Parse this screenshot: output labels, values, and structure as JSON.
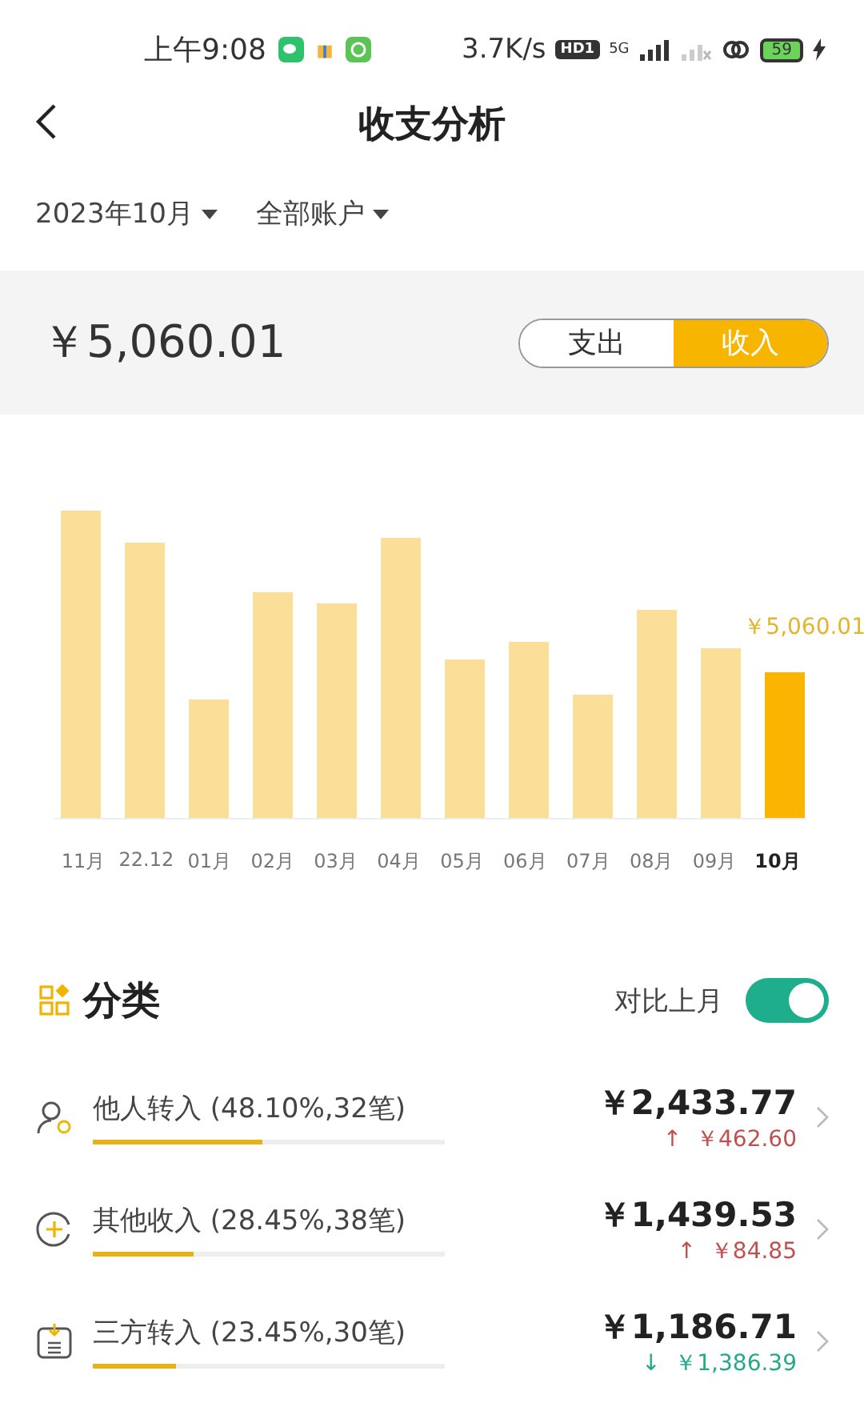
{
  "status_bar": {
    "time": "上午9:08",
    "speed": "3.7K/s",
    "hd_badge": "HD1",
    "network": "5G",
    "battery": "59"
  },
  "header": {
    "title": "收支分析"
  },
  "filters": [
    {
      "label": "2023年10月"
    },
    {
      "label": "全部账户"
    }
  ],
  "summary": {
    "amount": "￥5,060.01",
    "tabs": [
      {
        "label": "支出",
        "selected": false
      },
      {
        "label": "收入",
        "selected": true
      }
    ]
  },
  "chart": {
    "highlight_label": "￥5,060.01",
    "bars": [
      {
        "label": "11月",
        "selected": false
      },
      {
        "label": "22.12",
        "selected": false
      },
      {
        "label": "01月",
        "selected": false
      },
      {
        "label": "02月",
        "selected": false
      },
      {
        "label": "03月",
        "selected": false
      },
      {
        "label": "04月",
        "selected": false
      },
      {
        "label": "05月",
        "selected": false
      },
      {
        "label": "06月",
        "selected": false
      },
      {
        "label": "07月",
        "selected": false
      },
      {
        "label": "08月",
        "selected": false
      },
      {
        "label": "09月",
        "selected": false
      },
      {
        "label": "10月",
        "selected": true
      }
    ]
  },
  "category": {
    "title": "分类",
    "compare_label": "对比上月",
    "compare_on": true,
    "items": [
      {
        "kind": "person",
        "name": "他人转入",
        "detail": "(48.10%,32笔)",
        "level": 0.481,
        "amount": "￥2,433.77",
        "change": "￥462.60",
        "arrow": "↑",
        "color": "#c0504d"
      },
      {
        "kind": "other",
        "name": "其他收入",
        "detail": "(28.45%,38笔)",
        "level": 0.2845,
        "amount": "￥1,439.53",
        "change": "￥84.85",
        "arrow": "↑",
        "color": "#c0504d"
      },
      {
        "kind": "third",
        "name": "三方转入",
        "detail": "(23.45%,30笔)",
        "level": 0.2345,
        "amount": "￥1,186.71",
        "change": "￥1,386.39",
        "arrow": "↓",
        "color": "#23a98a"
      }
    ]
  }
}
